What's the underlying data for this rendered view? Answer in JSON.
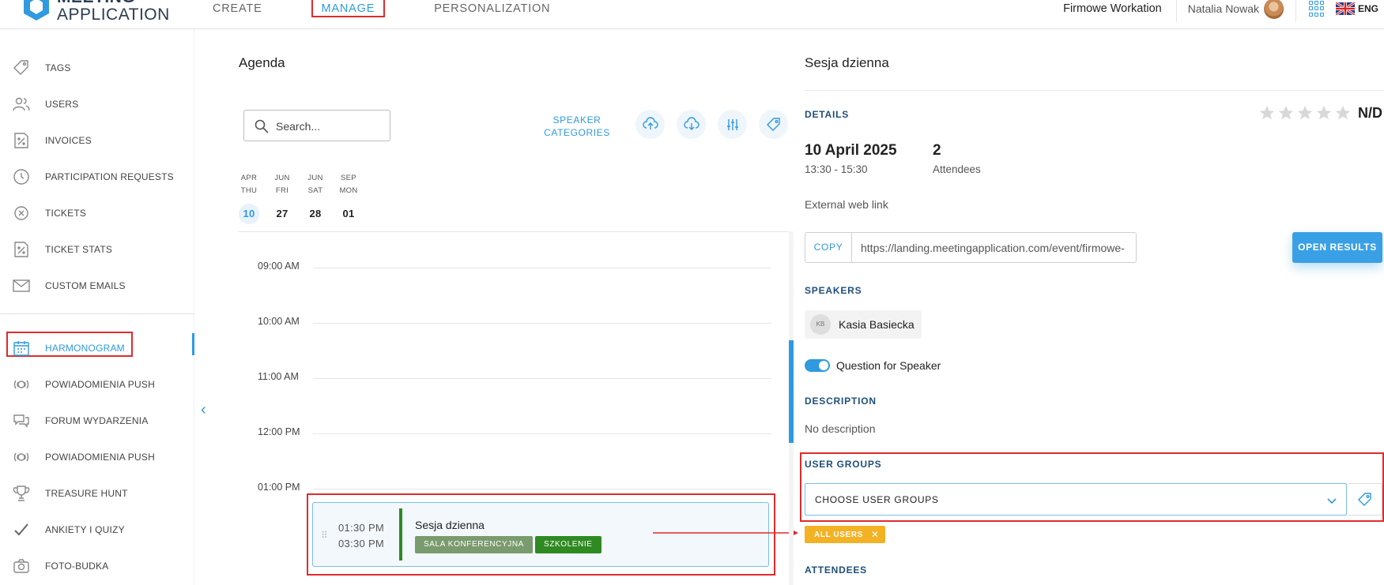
{
  "logo": {
    "line1": "MEETING",
    "line2": "APPLICATION"
  },
  "nav": {
    "create": "CREATE",
    "manage": "MANAGE",
    "personalization": "PERSONALIZATION"
  },
  "topbar": {
    "org": "Firmowe Workation",
    "user": "Natalia Nowak",
    "lang": "ENG"
  },
  "sidebar": {
    "items": [
      {
        "label": "TAGS",
        "icon": "tag-icon"
      },
      {
        "label": "USERS",
        "icon": "users-icon"
      },
      {
        "label": "INVOICES",
        "icon": "invoice-icon"
      },
      {
        "label": "PARTICIPATION REQUESTS",
        "icon": "clock-icon"
      },
      {
        "label": "TICKETS",
        "icon": "ticket-icon"
      },
      {
        "label": "TICKET STATS",
        "icon": "ticket-stats-icon"
      },
      {
        "label": "CUSTOM EMAILS",
        "icon": "envelope-icon"
      },
      {
        "label": "HARMONOGRAM",
        "icon": "calendar-icon"
      },
      {
        "label": "POWIADOMIENIA PUSH",
        "icon": "push-icon"
      },
      {
        "label": "FORUM WYDARZENIA",
        "icon": "forum-icon"
      },
      {
        "label": "POWIADOMIENIA PUSH",
        "icon": "push-icon"
      },
      {
        "label": "TREASURE HUNT",
        "icon": "trophy-icon"
      },
      {
        "label": "ANKIETY I QUIZY",
        "icon": "check-icon"
      },
      {
        "label": "FOTO-BUDKA",
        "icon": "camera-icon"
      }
    ]
  },
  "agenda": {
    "title": "Agenda",
    "search_placeholder": "Search...",
    "speaker_categories": "SPEAKER CATEGORIES",
    "days": [
      {
        "month": "APR",
        "weekday": "THU",
        "day": "10"
      },
      {
        "month": "JUN",
        "weekday": "FRI",
        "day": "27"
      },
      {
        "month": "JUN",
        "weekday": "SAT",
        "day": "28"
      },
      {
        "month": "SEP",
        "weekday": "MON",
        "day": "01"
      }
    ],
    "times": [
      "09:00 AM",
      "10:00 AM",
      "11:00 AM",
      "12:00 PM",
      "01:00 PM"
    ],
    "event": {
      "start": "01:30 PM",
      "end": "03:30 PM",
      "title": "Sesja dzienna",
      "tag1": "SALA KONFERENCYJNA",
      "tag2": "SZKOLENIE"
    }
  },
  "detail": {
    "title": "Sesja dzienna",
    "details_label": "DETAILS",
    "rating": "N/D",
    "date": "10 April 2025",
    "time": "13:30 - 15:30",
    "attendees_count": "2",
    "attendees_label": "Attendees",
    "external_link_label": "External web link",
    "copy": "COPY",
    "link": "https://landing.meetingapplication.com/event/firmowe-",
    "open_results": "OPEN RESULTS",
    "speakers_label": "SPEAKERS",
    "speaker_initials": "KB",
    "speaker_name": "Kasia Basiecka",
    "question_for_speaker": "Question for Speaker",
    "description_label": "DESCRIPTION",
    "description": "No description",
    "user_groups_label": "USER GROUPS",
    "choose_user_groups": "CHOOSE USER GROUPS",
    "all_users": "ALL USERS",
    "attendees_section": "ATTENDEES"
  },
  "colors": {
    "accent": "#2f9ae0",
    "highlight": "#e02b2b",
    "event_green": "#2f8a22",
    "tag_grey_green": "#7a9b6d",
    "chip_yellow": "#f3b224"
  }
}
